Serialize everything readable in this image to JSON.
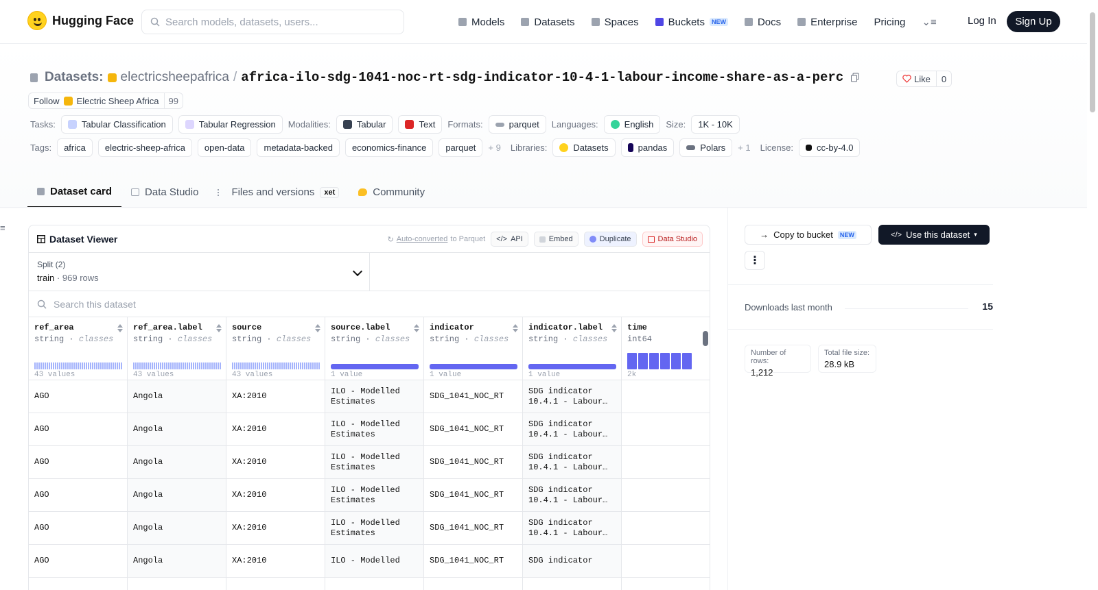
{
  "header": {
    "brand": "Hugging Face",
    "search_placeholder": "Search models, datasets, users...",
    "nav": [
      {
        "label": "Models",
        "icon": "cube-icon",
        "color": "#9ca3af"
      },
      {
        "label": "Datasets",
        "icon": "database-icon",
        "color": "#9ca3af"
      },
      {
        "label": "Spaces",
        "icon": "grid-icon",
        "color": "#9ca3af"
      },
      {
        "label": "Buckets",
        "icon": "bucket-icon",
        "color": "#4f46e5",
        "badge": "NEW"
      },
      {
        "label": "Docs",
        "icon": "book-icon",
        "color": "#9ca3af"
      },
      {
        "label": "Enterprise",
        "icon": "enterprise-icon",
        "color": "#9ca3af"
      },
      {
        "label": "Pricing"
      }
    ],
    "login": "Log In",
    "signup": "Sign Up"
  },
  "repo": {
    "kind": "Datasets:",
    "owner": "electricsheepafrica",
    "separator": "/",
    "name": "africa-ilo-sdg-1041-noc-rt-sdg-indicator-10-4-1-labour-income-share-as-a-perc",
    "like_label": "Like",
    "like_count": "0",
    "follow_label": "Follow",
    "follow_org": "Electric Sheep Africa",
    "follow_count": "99"
  },
  "meta": {
    "tasks_label": "Tasks:",
    "tasks": [
      "Tabular Classification",
      "Tabular Regression"
    ],
    "modalities_label": "Modalities:",
    "modalities": [
      "Tabular",
      "Text"
    ],
    "formats_label": "Formats:",
    "formats": [
      "parquet"
    ],
    "languages_label": "Languages:",
    "languages": [
      "English"
    ],
    "size_label": "Size:",
    "size": "1K - 10K",
    "tags_label": "Tags:",
    "tags": [
      "africa",
      "electric-sheep-africa",
      "open-data",
      "metadata-backed",
      "economics-finance",
      "parquet"
    ],
    "tags_more": "+ 9",
    "libraries_label": "Libraries:",
    "libraries": [
      "Datasets",
      "pandas",
      "Polars"
    ],
    "libraries_more": "+ 1",
    "license_label": "License:",
    "license": "cc-by-4.0"
  },
  "tabs": [
    {
      "label": "Dataset card",
      "active": true
    },
    {
      "label": "Data Studio"
    },
    {
      "label": "Files and versions",
      "badge": "xet"
    },
    {
      "label": "Community"
    }
  ],
  "viewer": {
    "title": "Dataset Viewer",
    "auto_converted": "Auto-converted",
    "to_parquet": "to Parquet",
    "api": "API",
    "embed": "Embed",
    "duplicate": "Duplicate",
    "data_studio": "Data Studio",
    "split_label": "Split (2)",
    "split_value": "train",
    "split_dot": "·",
    "split_rows": "969 rows",
    "search_placeholder": "Search this dataset",
    "columns": [
      {
        "name": "ref_area",
        "type": "string",
        "kind": "classes",
        "count": "43 values",
        "viz": "hist"
      },
      {
        "name": "ref_area.label",
        "type": "string",
        "kind": "classes",
        "count": "43 values",
        "viz": "hist"
      },
      {
        "name": "source",
        "type": "string",
        "kind": "classes",
        "count": "43 values",
        "viz": "hist"
      },
      {
        "name": "source.label",
        "type": "string",
        "kind": "classes",
        "count": "1 value",
        "viz": "bar"
      },
      {
        "name": "indicator",
        "type": "string",
        "kind": "classes",
        "count": "1 value",
        "viz": "bar"
      },
      {
        "name": "indicator.label",
        "type": "string",
        "kind": "classes",
        "count": "1 value",
        "viz": "bar"
      },
      {
        "name": "time",
        "type": "int64",
        "kind": "",
        "count": "2k",
        "viz": "time"
      }
    ],
    "rows": [
      [
        "AGO",
        "Angola",
        "XA:2010",
        "ILO - Modelled\nEstimates",
        "SDG_1041_NOC_RT",
        "SDG indicator\n10.4.1 - Labour…",
        ""
      ],
      [
        "AGO",
        "Angola",
        "XA:2010",
        "ILO - Modelled\nEstimates",
        "SDG_1041_NOC_RT",
        "SDG indicator\n10.4.1 - Labour…",
        ""
      ],
      [
        "AGO",
        "Angola",
        "XA:2010",
        "ILO - Modelled\nEstimates",
        "SDG_1041_NOC_RT",
        "SDG indicator\n10.4.1 - Labour…",
        ""
      ],
      [
        "AGO",
        "Angola",
        "XA:2010",
        "ILO - Modelled\nEstimates",
        "SDG_1041_NOC_RT",
        "SDG indicator\n10.4.1 - Labour…",
        ""
      ],
      [
        "AGO",
        "Angola",
        "XA:2010",
        "ILO - Modelled\nEstimates",
        "SDG_1041_NOC_RT",
        "SDG indicator\n10.4.1 - Labour…",
        ""
      ],
      [
        "AGO",
        "Angola",
        "XA:2010",
        "ILO - Modelled",
        "SDG_1041_NOC_RT",
        "SDG indicator",
        ""
      ]
    ]
  },
  "side": {
    "copy_bucket": "Copy to bucket",
    "copy_badge": "NEW",
    "use_dataset": "Use this dataset",
    "downloads_label": "Downloads last month",
    "downloads_value": "15",
    "rows_label": "Number of rows:",
    "rows_value": "1,212",
    "size_label": "Total file size:",
    "size_value": "28.9 kB"
  }
}
